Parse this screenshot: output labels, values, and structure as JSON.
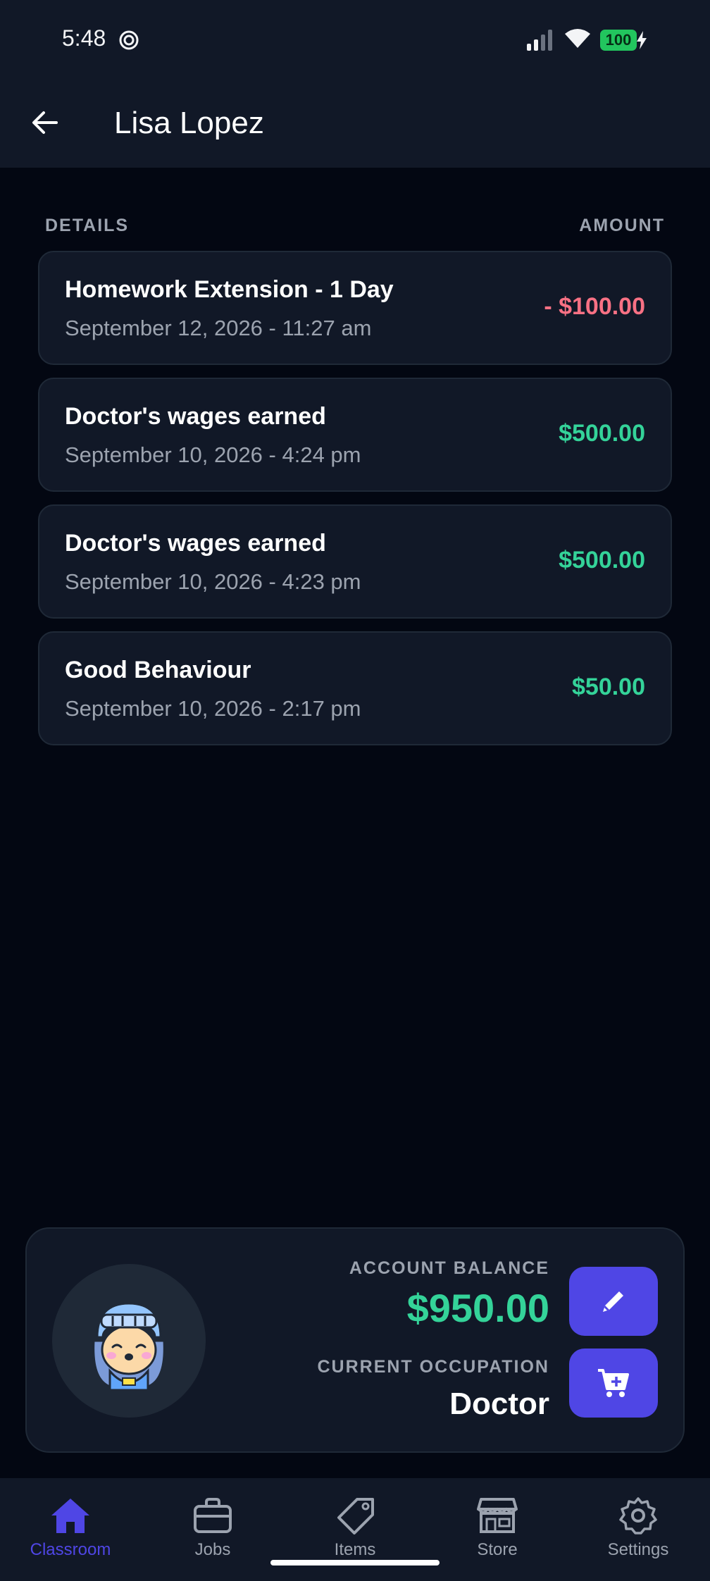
{
  "status_bar": {
    "time": "5:48",
    "battery": "100"
  },
  "header": {
    "title": "Lisa Lopez"
  },
  "columns": {
    "details": "DETAILS",
    "amount": "AMOUNT"
  },
  "transactions": [
    {
      "title": "Homework Extension - 1 Day",
      "date": "September 12, 2026 - 11:27 am",
      "amount": "- $100.00",
      "type": "debit"
    },
    {
      "title": "Doctor's wages earned",
      "date": "September 10, 2026 - 4:24 pm",
      "amount": "$500.00",
      "type": "credit"
    },
    {
      "title": "Doctor's wages earned",
      "date": "September 10, 2026 - 4:23 pm",
      "amount": "$500.00",
      "type": "credit"
    },
    {
      "title": "Good Behaviour",
      "date": "September 10, 2026 - 2:17 pm",
      "amount": "$50.00",
      "type": "credit"
    }
  ],
  "summary": {
    "balance_label": "ACCOUNT BALANCE",
    "balance": "$950.00",
    "occupation_label": "CURRENT OCCUPATION",
    "occupation": "Doctor",
    "avatar_icon": "knight-avatar-icon"
  },
  "nav": [
    {
      "label": "Classroom",
      "icon": "home-icon",
      "active": true
    },
    {
      "label": "Jobs",
      "icon": "briefcase-icon",
      "active": false
    },
    {
      "label": "Items",
      "icon": "tag-icon",
      "active": false
    },
    {
      "label": "Store",
      "icon": "store-icon",
      "active": false
    },
    {
      "label": "Settings",
      "icon": "gear-icon",
      "active": false
    }
  ],
  "colors": {
    "background": "#030712",
    "surface": "#111827",
    "accent": "#4f46e5",
    "positive": "#34d399",
    "negative": "#f87184"
  }
}
